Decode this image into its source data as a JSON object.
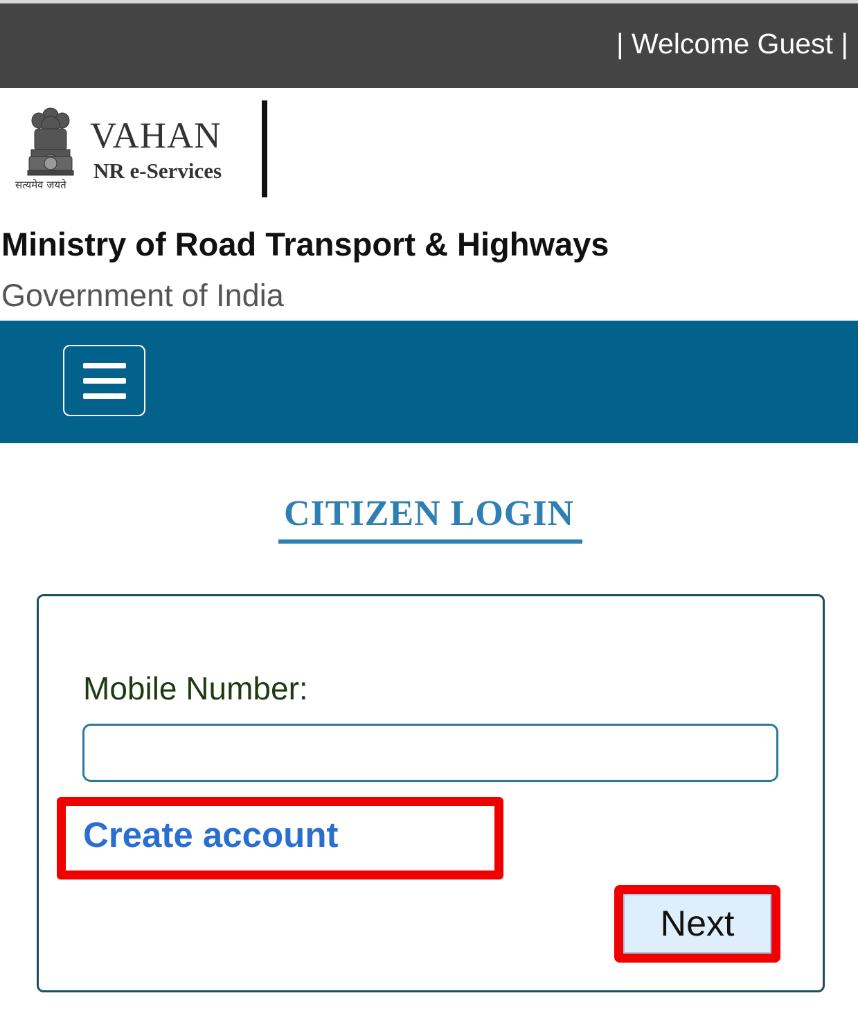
{
  "header": {
    "welcome_text": "| Welcome Guest |"
  },
  "branding": {
    "emblem_motto": "सत्यमेव जयते",
    "title": "VAHAN",
    "subtitle": "NR e-Services",
    "ministry": "Ministry of Road Transport & Highways",
    "government": "Government of India"
  },
  "navbar": {
    "menu_icon": "hamburger-menu-icon"
  },
  "login": {
    "title": "CITIZEN LOGIN",
    "mobile_label": "Mobile Number:",
    "mobile_value": "",
    "create_account_label": "Create account",
    "next_label": "Next"
  },
  "colors": {
    "topbar": "#444444",
    "navbar": "#03628b",
    "title_blue": "#2e7fb3",
    "link_blue": "#2a6fd0",
    "highlight_red": "#f00000"
  }
}
